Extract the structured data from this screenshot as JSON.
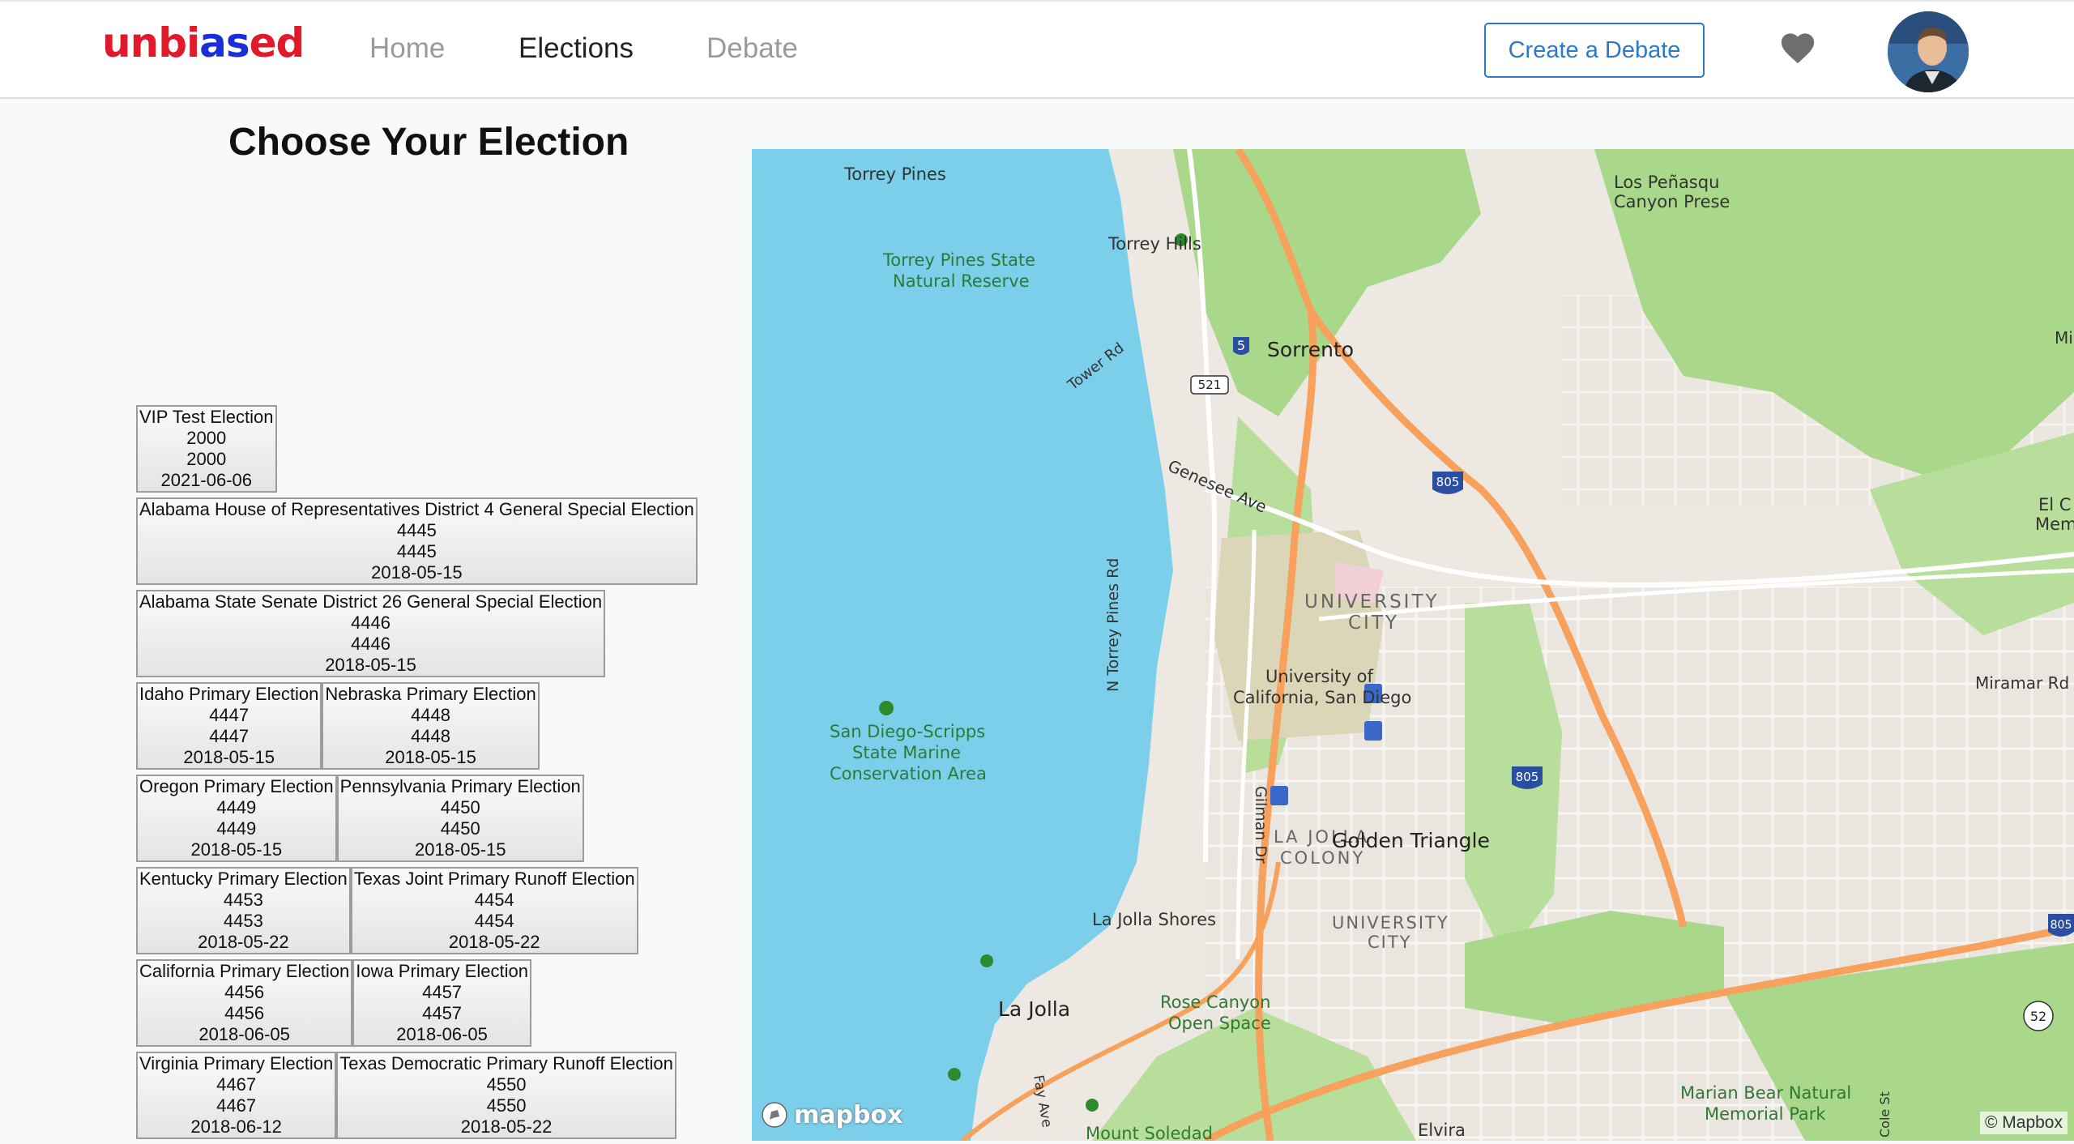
{
  "brand": {
    "part1": "unbi",
    "part2": "as",
    "part3": "ed"
  },
  "nav": {
    "home": "Home",
    "elections": "Elections",
    "debate": "Debate"
  },
  "header": {
    "create_debate": "Create a Debate",
    "heart_icon": "heart-icon",
    "avatar_icon": "user-avatar"
  },
  "page": {
    "title": "Choose Your Election"
  },
  "elections": [
    [
      {
        "name": "VIP Test Election",
        "id1": "2000",
        "id2": "2000",
        "date": "2021-06-06"
      }
    ],
    [
      {
        "name": "Alabama House of Representatives District 4 General Special Election",
        "id1": "4445",
        "id2": "4445",
        "date": "2018-05-15"
      }
    ],
    [
      {
        "name": "Alabama State Senate District 26 General Special Election",
        "id1": "4446",
        "id2": "4446",
        "date": "2018-05-15"
      }
    ],
    [
      {
        "name": "Idaho Primary Election",
        "id1": "4447",
        "id2": "4447",
        "date": "2018-05-15"
      },
      {
        "name": "Nebraska Primary Election",
        "id1": "4448",
        "id2": "4448",
        "date": "2018-05-15"
      }
    ],
    [
      {
        "name": "Oregon Primary Election",
        "id1": "4449",
        "id2": "4449",
        "date": "2018-05-15"
      },
      {
        "name": "Pennsylvania Primary Election",
        "id1": "4450",
        "id2": "4450",
        "date": "2018-05-15"
      }
    ],
    [
      {
        "name": "Kentucky Primary Election",
        "id1": "4453",
        "id2": "4453",
        "date": "2018-05-22"
      },
      {
        "name": "Texas Joint Primary Runoff Election",
        "id1": "4454",
        "id2": "4454",
        "date": "2018-05-22"
      }
    ],
    [
      {
        "name": "California Primary Election",
        "id1": "4456",
        "id2": "4456",
        "date": "2018-06-05"
      },
      {
        "name": "Iowa Primary Election",
        "id1": "4457",
        "id2": "4457",
        "date": "2018-06-05"
      }
    ],
    [
      {
        "name": "Virginia Primary Election",
        "id1": "4467",
        "id2": "4467",
        "date": "2018-06-12"
      },
      {
        "name": "Texas Democratic Primary Runoff Election",
        "id1": "4550",
        "id2": "4550",
        "date": "2018-05-22"
      }
    ]
  ],
  "map": {
    "labels": {
      "torrey_pines": "Torrey Pines",
      "torrey_pines_reserve_1": "Torrey Pines State",
      "torrey_pines_reserve_2": "Natural Reserve",
      "torrey_hills": "Torrey Hills",
      "los_penasquitos_1": "Los Peñasqu",
      "los_penasquitos_2": "Canyon Prese",
      "sorrento": "Sorrento",
      "tower_rd": "Tower Rd",
      "genesee_ave": "Genesee Ave",
      "university_city_1": "UNIVERSITY",
      "university_city_2": "CITY",
      "ucsd_1": "University of",
      "ucsd_2": "California, San Diego",
      "n_torrey_pines_rd": "N Torrey Pines Rd",
      "scripps_1": "San Diego-Scripps",
      "scripps_2": "State Marine",
      "scripps_3": "Conservation Area",
      "el_c_1": "El C",
      "el_c_2": "Memo",
      "miramar_rd": "Miramar Rd",
      "mira": "Mira",
      "gilman_dr": "Gilman Dr",
      "la_jolla_colony_1": "LA JOLLA",
      "la_jolla_colony_2": "COLONY",
      "golden_triangle": "Golden Triangle",
      "la_jolla_shores": "La Jolla Shores",
      "university_city_s1": "UNIVERSITY",
      "university_city_s2": "CITY",
      "la_jolla": "La Jolla",
      "rose_canyon_1": "Rose Canyon",
      "rose_canyon_2": "Open Space",
      "fay_ave": "Fay Ave",
      "mount_soledad": "Mount Soledad",
      "elvira": "Elvira",
      "marian_bear_1": "Marian Bear Natural",
      "marian_bear_2": "Memorial Park",
      "cole_st": "Cole St"
    },
    "shields": {
      "i5": "5",
      "r521": "521",
      "i805a": "805",
      "i805b": "805",
      "i805c": "805",
      "r52": "52"
    },
    "logo": "mapbox",
    "attribution": "© Mapbox",
    "colors": {
      "water": "#7ccfeb",
      "land": "#ede8e1",
      "park": "#a9d88a",
      "highway": "#f7a15c",
      "campus": "#dcd6b8"
    }
  }
}
